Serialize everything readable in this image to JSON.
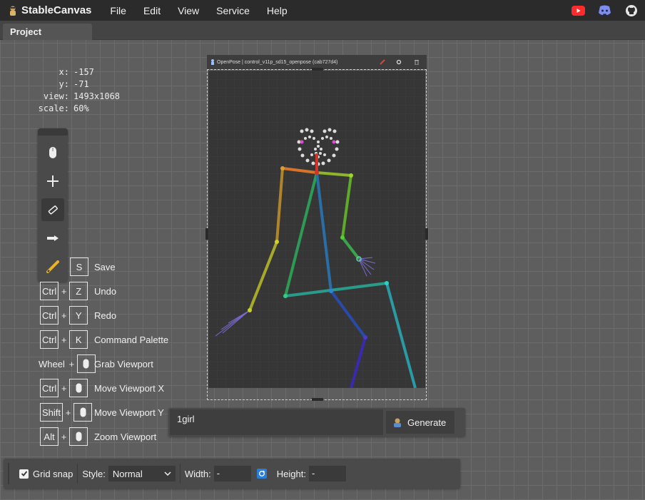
{
  "app": {
    "title": "StableCanvas"
  },
  "menu": [
    "File",
    "Edit",
    "View",
    "Service",
    "Help"
  ],
  "header_icons": [
    "youtube-icon",
    "discord-icon",
    "github-icon"
  ],
  "tabs": [
    {
      "label": "Project"
    }
  ],
  "viewport": {
    "x_label": "x:",
    "x": "-157",
    "y_label": "y:",
    "y": "-71",
    "view_label": "view:",
    "view": "1493x1068",
    "scale_label": "scale:",
    "scale": "60%"
  },
  "tools": [
    "mouse-icon",
    "move-crosshair-icon",
    "eraser-icon",
    "arrow-tool-icon",
    "pencil-icon"
  ],
  "shortcuts": [
    {
      "keys": [
        "S"
      ],
      "label": "Save"
    },
    {
      "keys": [
        "Ctrl",
        "Z"
      ],
      "label": "Undo"
    },
    {
      "keys": [
        "Ctrl",
        "Y"
      ],
      "label": "Redo"
    },
    {
      "keys": [
        "Ctrl",
        "K"
      ],
      "label": "Command Palette"
    },
    {
      "keys": [
        "Wheel",
        "mouse"
      ],
      "label": "Grab Viewport"
    },
    {
      "keys": [
        "Ctrl",
        "mouse"
      ],
      "label": "Move Viewport X"
    },
    {
      "keys": [
        "Shift",
        "mouse"
      ],
      "label": "Move Viewport Y"
    },
    {
      "keys": [
        "Alt",
        "mouse"
      ],
      "label": "Zoom Viewport"
    }
  ],
  "node": {
    "title": "OpenPose | control_v11p_sd15_openpose (cab727d4)"
  },
  "prompt": {
    "value": "1girl"
  },
  "generate": {
    "label": "Generate"
  },
  "bottom": {
    "grid_snap_label": "Grid snap",
    "grid_snap_checked": true,
    "style_label": "Style:",
    "style_value": "Normal",
    "width_label": "Width:",
    "width_value": "-",
    "height_label": "Height:",
    "height_value": "-"
  },
  "colors": {
    "menubar": "#2b2b2b",
    "canvas_bg": "#5e5e5e",
    "panel": "#4a4a4a",
    "accent_blue": "#2a7fd4"
  }
}
